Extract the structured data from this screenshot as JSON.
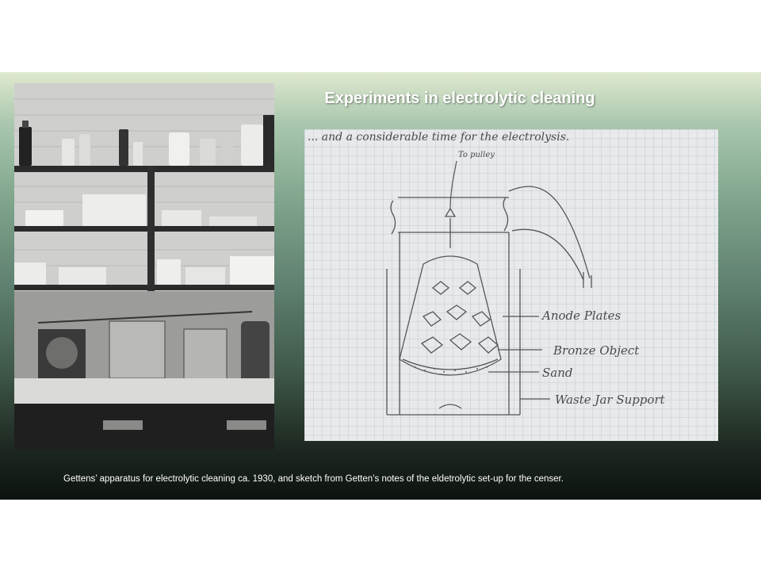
{
  "slide": {
    "title": "Experiments in electrolytic cleaning",
    "caption": "Gettens’ apparatus for electrolytic cleaning ca. 1930, and sketch from Getten’s notes of the eldetrolytic set-up for the censer."
  },
  "photo": {
    "description_icon": "lab-photo"
  },
  "sketch": {
    "top_note": "... and a considerable time for the electrolysis.",
    "pulley_label": "To pulley",
    "labels": {
      "anode": "Anode Plates",
      "bronze": "Bronze Object",
      "sand": "Sand",
      "support": "Waste Jar Support"
    }
  },
  "colors": {
    "slide_top": "#dfe9cf",
    "slide_bottom": "#0d130f",
    "title": "#ffffff",
    "paper": "#e7e9ea",
    "grid": "#b9c3cf"
  }
}
